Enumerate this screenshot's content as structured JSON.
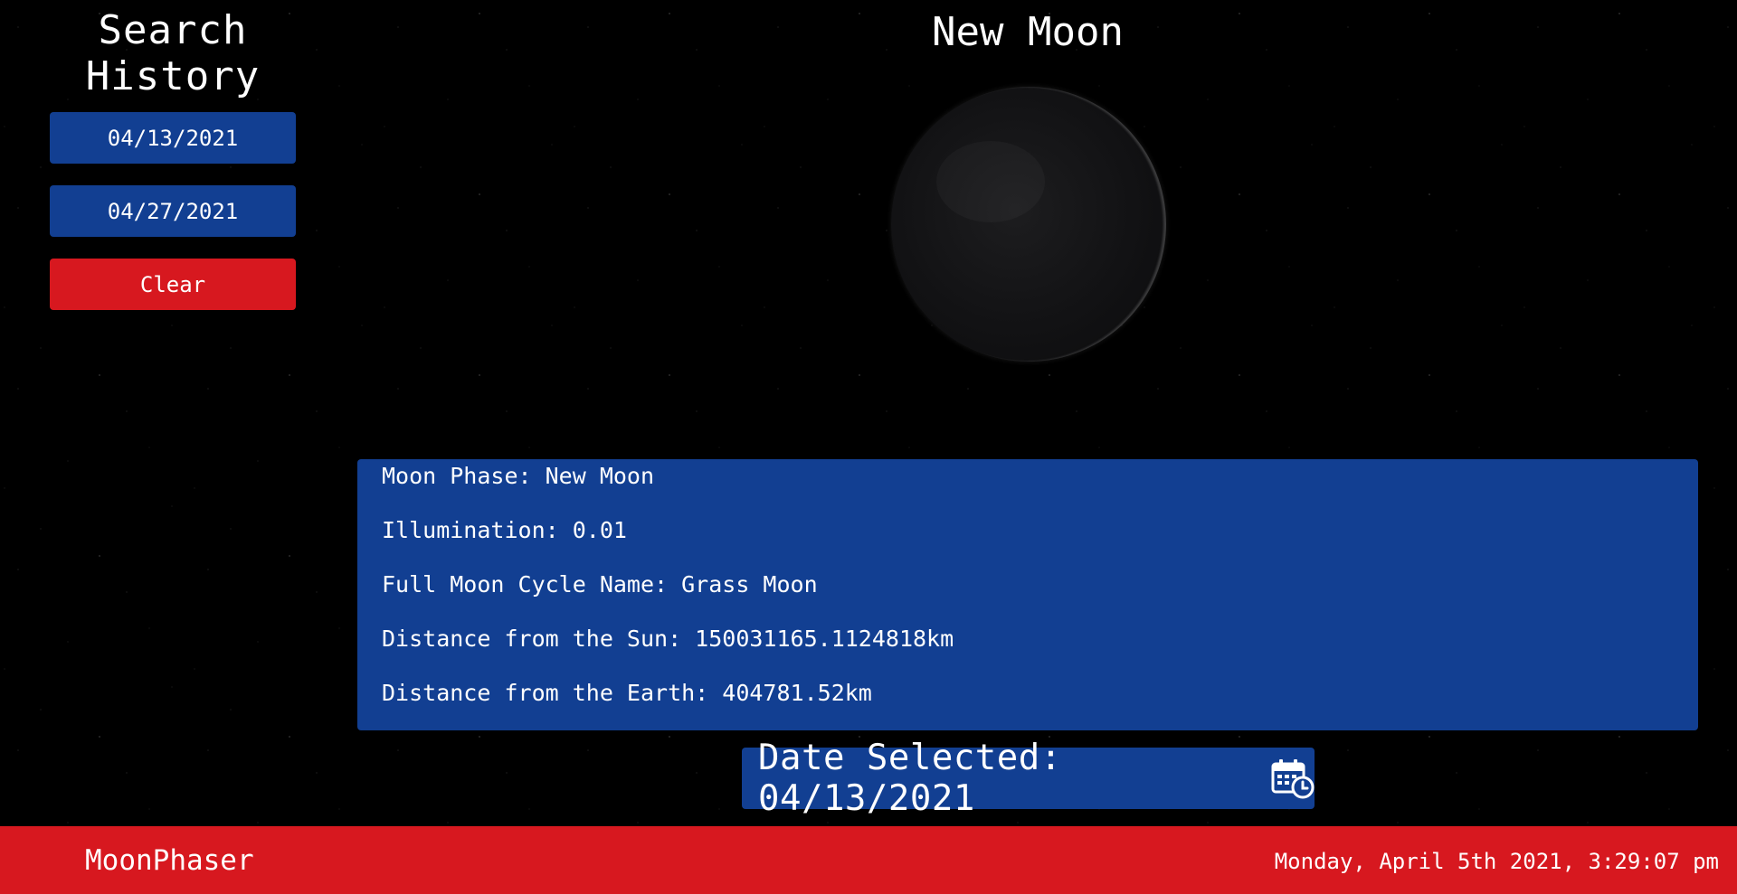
{
  "sidebar": {
    "title": "Search\nHistory",
    "title_line1": "Search",
    "title_line2": "History",
    "history": [
      "04/13/2021",
      "04/27/2021"
    ],
    "clear_label": "Clear"
  },
  "main": {
    "phase_title": "New Moon",
    "info": {
      "moon_phase": "Moon Phase: New Moon",
      "illumination": "Illumination: 0.01",
      "cycle_name": "Full Moon Cycle Name: Grass Moon",
      "sun_distance": "Distance from the Sun: 150031165.1124818km",
      "earth_distance": "Distance from the Earth: 404781.52km"
    },
    "date_selected": "Date Selected: 04/13/2021",
    "date_icon": "calendar-clock-icon"
  },
  "footer": {
    "brand": "MoonPhaser",
    "datetime": "Monday, April 5th 2021, 3:29:07 pm"
  },
  "colors": {
    "primary_blue": "#123f92",
    "accent_red": "#d7181f",
    "background": "#000000"
  }
}
